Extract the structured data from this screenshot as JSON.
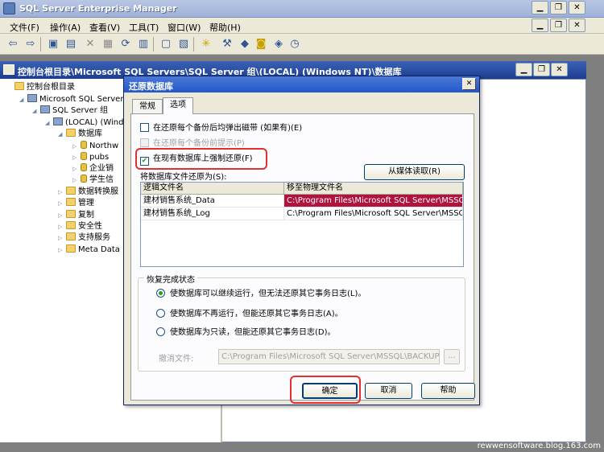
{
  "app": {
    "title": "SQL Server Enterprise Manager",
    "menu": [
      "文件(F)",
      "操作(A)",
      "查看(V)",
      "工具(T)",
      "窗口(W)",
      "帮助(H)"
    ]
  },
  "child_window": {
    "title": "控制台根目录\\Microsoft SQL Servers\\SQL Server 组\\(LOCAL) (Windows NT)\\数据库"
  },
  "tree": {
    "root": "控制台根目录",
    "sql_servers": "Microsoft SQL Servers",
    "group": "SQL Server 组",
    "local": "(LOCAL) (Wind",
    "databases": "数据库",
    "db_items": [
      "Northw",
      "pubs",
      "企业销",
      "学生信"
    ],
    "other_nodes": [
      "数据转换服",
      "管理",
      "复制",
      "安全性",
      "支持服务",
      "Meta Data"
    ]
  },
  "dialog": {
    "title": "还原数据库",
    "close_glyph": "✕",
    "tabs": [
      "常规",
      "选项"
    ],
    "options": {
      "eject_tapes": "在还原每个备份后均弹出磁带 (如果有)(E)",
      "prompt_before": "在还原每个备份前提示(P)",
      "force_restore": "在现有数据库上强制还原(F)"
    },
    "restore_as_label": "将数据库文件还原为(S):",
    "from_media_button": "从媒体读取(R)",
    "grid": {
      "headers": [
        "逻辑文件名",
        "移至物理文件名"
      ],
      "rows": [
        [
          "建材销售系统_Data",
          "C:\\Program Files\\Microsoft SQL Server\\MSSQL"
        ],
        [
          "建材销售系统_Log",
          "C:\\Program Files\\Microsoft SQL Server\\MSSQL"
        ]
      ]
    },
    "recovery_group": "恢复完成状态",
    "recovery_options": [
      "使数据库可以继续运行，但无法还原其它事务日志(L)。",
      "使数据库不再运行，但能还原其它事务日志(A)。",
      "使数据库为只读，但能还原其它事务日志(D)。"
    ],
    "undo_file_label": "撤消文件:",
    "undo_file_value": "C:\\Program Files\\Microsoft SQL Server\\MSSQL\\BACKUP\\UN",
    "browse_label": "...",
    "buttons": {
      "ok": "确定",
      "cancel": "取消",
      "help": "帮助"
    }
  },
  "footer": "rewwensoftware.blog.163.com",
  "colors": {
    "selection": "#b0133d",
    "highlight_ring": "#e03030",
    "title_blue": "#2358c8"
  }
}
